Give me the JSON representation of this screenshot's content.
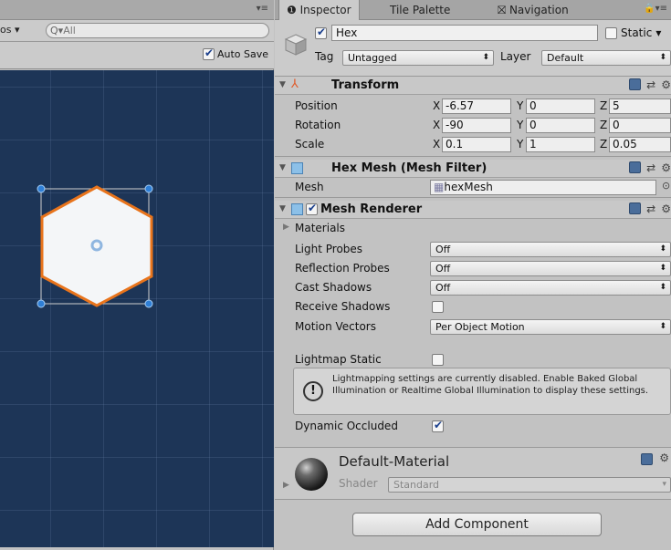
{
  "scene": {
    "gizmos_label": "os ▾",
    "search_placeholder": "All",
    "auto_save_label": "Auto Save",
    "auto_save_checked": true,
    "grid_color": "#1d3557",
    "hex_outline_color": "#e8741c"
  },
  "tabs": {
    "inspector": "Inspector",
    "tile_palette": "Tile Palette",
    "navigation": "Navigation"
  },
  "gameobject": {
    "active": true,
    "name": "Hex",
    "static_label": "Static",
    "tag_label": "Tag",
    "tag_value": "Untagged",
    "layer_label": "Layer",
    "layer_value": "Default"
  },
  "transform": {
    "title": "Transform",
    "position_label": "Position",
    "rotation_label": "Rotation",
    "scale_label": "Scale",
    "position": {
      "x": "-6.57",
      "y": "0",
      "z": "5"
    },
    "rotation": {
      "x": "-90",
      "y": "0",
      "z": "0"
    },
    "scale": {
      "x": "0.1",
      "y": "1",
      "z": "0.05"
    },
    "axis_x": "X",
    "axis_y": "Y",
    "axis_z": "Z"
  },
  "mesh_filter": {
    "title": "Hex Mesh (Mesh Filter)",
    "mesh_label": "Mesh",
    "mesh_value": "hexMesh"
  },
  "mesh_renderer": {
    "title": "Mesh Renderer",
    "enabled": true,
    "materials_label": "Materials",
    "light_probes_label": "Light Probes",
    "light_probes_value": "Off",
    "reflection_probes_label": "Reflection Probes",
    "reflection_probes_value": "Off",
    "cast_shadows_label": "Cast Shadows",
    "cast_shadows_value": "Off",
    "receive_shadows_label": "Receive Shadows",
    "receive_shadows_checked": false,
    "motion_vectors_label": "Motion Vectors",
    "motion_vectors_value": "Per Object Motion",
    "lightmap_static_label": "Lightmap Static",
    "lightmap_static_checked": false,
    "info_text": "Lightmapping settings are currently disabled. Enable Baked Global Illumination or Realtime Global Illumination to display these settings.",
    "dynamic_occluded_label": "Dynamic Occluded",
    "dynamic_occluded_checked": true
  },
  "material": {
    "name": "Default-Material",
    "shader_label": "Shader",
    "shader_value": "Standard"
  },
  "add_component_label": "Add Component"
}
